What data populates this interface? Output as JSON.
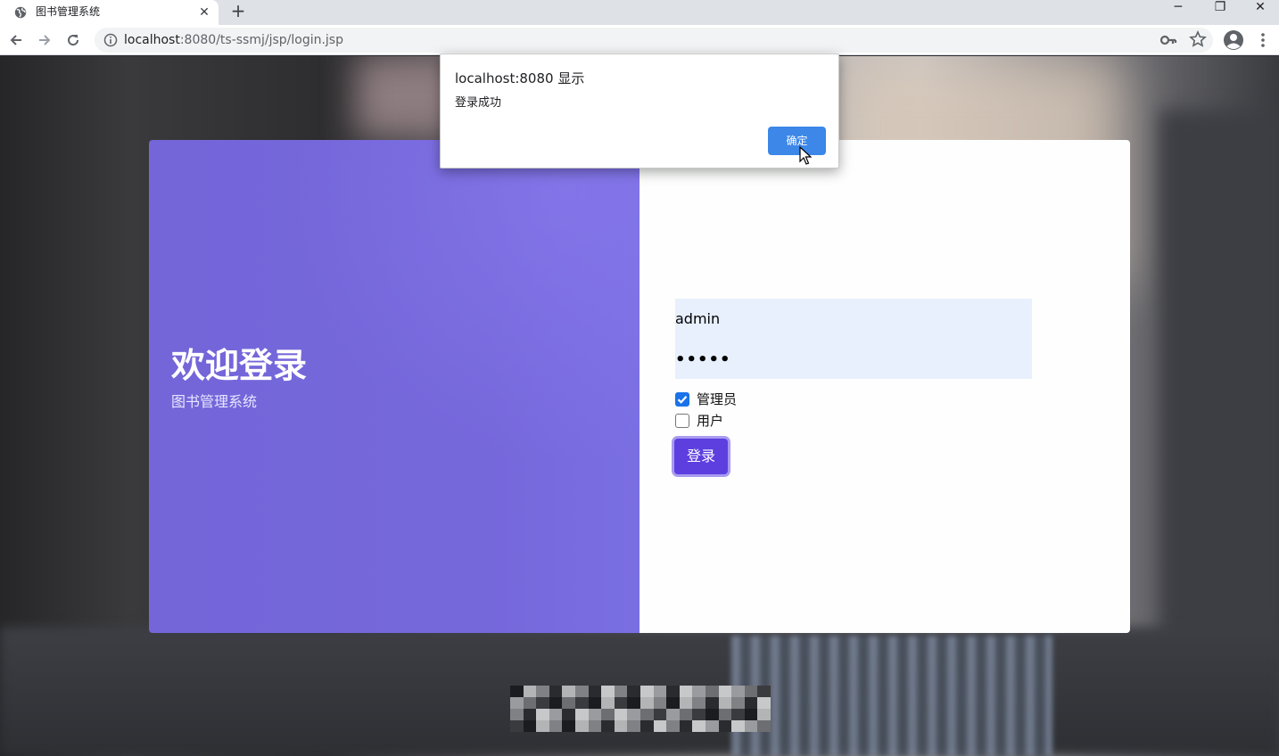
{
  "browser": {
    "tab_title": "图书管理系统",
    "tab_close_glyph": "✕",
    "new_tab_glyph": "+",
    "window_minimize_glyph": "─",
    "window_restore_glyph": "❐",
    "window_close_glyph": "✕",
    "url_host": "localhost",
    "url_rest": ":8080/ts-ssmj/jsp/login.jsp",
    "icons": {
      "favicon": "globe-icon",
      "back": "back-arrow-icon",
      "forward": "forward-arrow-icon",
      "reload": "reload-icon",
      "site_info": "info-icon",
      "passwords": "key-icon",
      "bookmark": "star-icon",
      "profile": "profile-icon",
      "menu": "kebab-menu-icon"
    }
  },
  "login": {
    "welcome_title": "欢迎登录",
    "subtitle": "图书管理系统",
    "username_value": "admin",
    "password_mask": "•••••",
    "role_admin_label": "管理员",
    "role_admin_checked": true,
    "role_user_label": "用户",
    "role_user_checked": false,
    "login_button_label": "登录",
    "colors": {
      "left_panel": "#7568db",
      "button": "#5d3fe0",
      "input_autofill": "#e8f0fe",
      "checkbox_checked": "#1a73e8"
    }
  },
  "alert": {
    "title": "localhost:8080 显示",
    "message": "登录成功",
    "ok_label": "确定",
    "ok_color": "#3c87e8"
  }
}
